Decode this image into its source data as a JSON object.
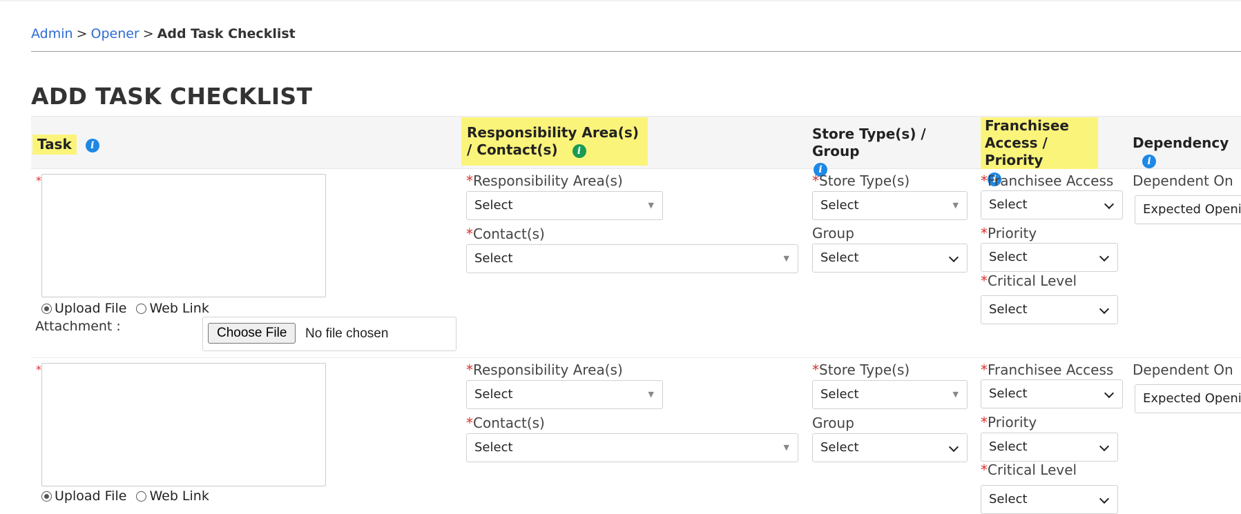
{
  "breadcrumb": {
    "items": [
      "Admin",
      "Opener"
    ],
    "separator": ">",
    "current": "Add Task Checklist"
  },
  "page_title": "ADD TASK CHECKLIST",
  "table_header": {
    "task": "Task",
    "responsibility": "Responsibility Area(s) / Contact(s)",
    "store_type": "Store Type(s) / Group",
    "franchisee": "Franchisee Access / Priority",
    "dependency": "Dependency"
  },
  "rows": [
    {
      "required_mark": "*",
      "upload_file_label": "Upload File",
      "web_link_label": "Web Link",
      "attachment_label": "Attachment :",
      "choose_file_label": "Choose File",
      "file_status": "No file chosen",
      "responsibility_area_label": "Responsibility Area(s)",
      "responsibility_area_value": "Select",
      "contacts_label": "Contact(s)",
      "contacts_value": "Select",
      "store_types_label": "Store Type(s)",
      "store_types_value": "Select",
      "group_label": "Group",
      "group_value": "Select",
      "franchisee_access_label": "Franchisee Access",
      "franchisee_access_value": "Select",
      "priority_label": "Priority",
      "priority_value": "Select",
      "critical_level_label": "Critical Level",
      "critical_level_value": "Select",
      "dependent_on_label": "Dependent On",
      "dependent_on_value": "Expected Openin"
    },
    {
      "required_mark": "*",
      "upload_file_label": "Upload File",
      "web_link_label": "Web Link",
      "responsibility_area_label": "Responsibility Area(s)",
      "responsibility_area_value": "Select",
      "contacts_label": "Contact(s)",
      "contacts_value": "Select",
      "store_types_label": "Store Type(s)",
      "store_types_value": "Select",
      "group_label": "Group",
      "group_value": "Select",
      "franchisee_access_label": "Franchisee Access",
      "franchisee_access_value": "Select",
      "priority_label": "Priority",
      "priority_value": "Select",
      "critical_level_label": "Critical Level",
      "critical_level_value": "Select",
      "dependent_on_label": "Dependent On",
      "dependent_on_value": "Expected Openin"
    }
  ],
  "icons": {
    "info": "info-icon"
  },
  "colors": {
    "link": "#2f6bd1",
    "highlight": "#fbf47a",
    "required": "#d9302c",
    "info_blue": "#1e88e5",
    "info_green": "#1a9b54"
  }
}
